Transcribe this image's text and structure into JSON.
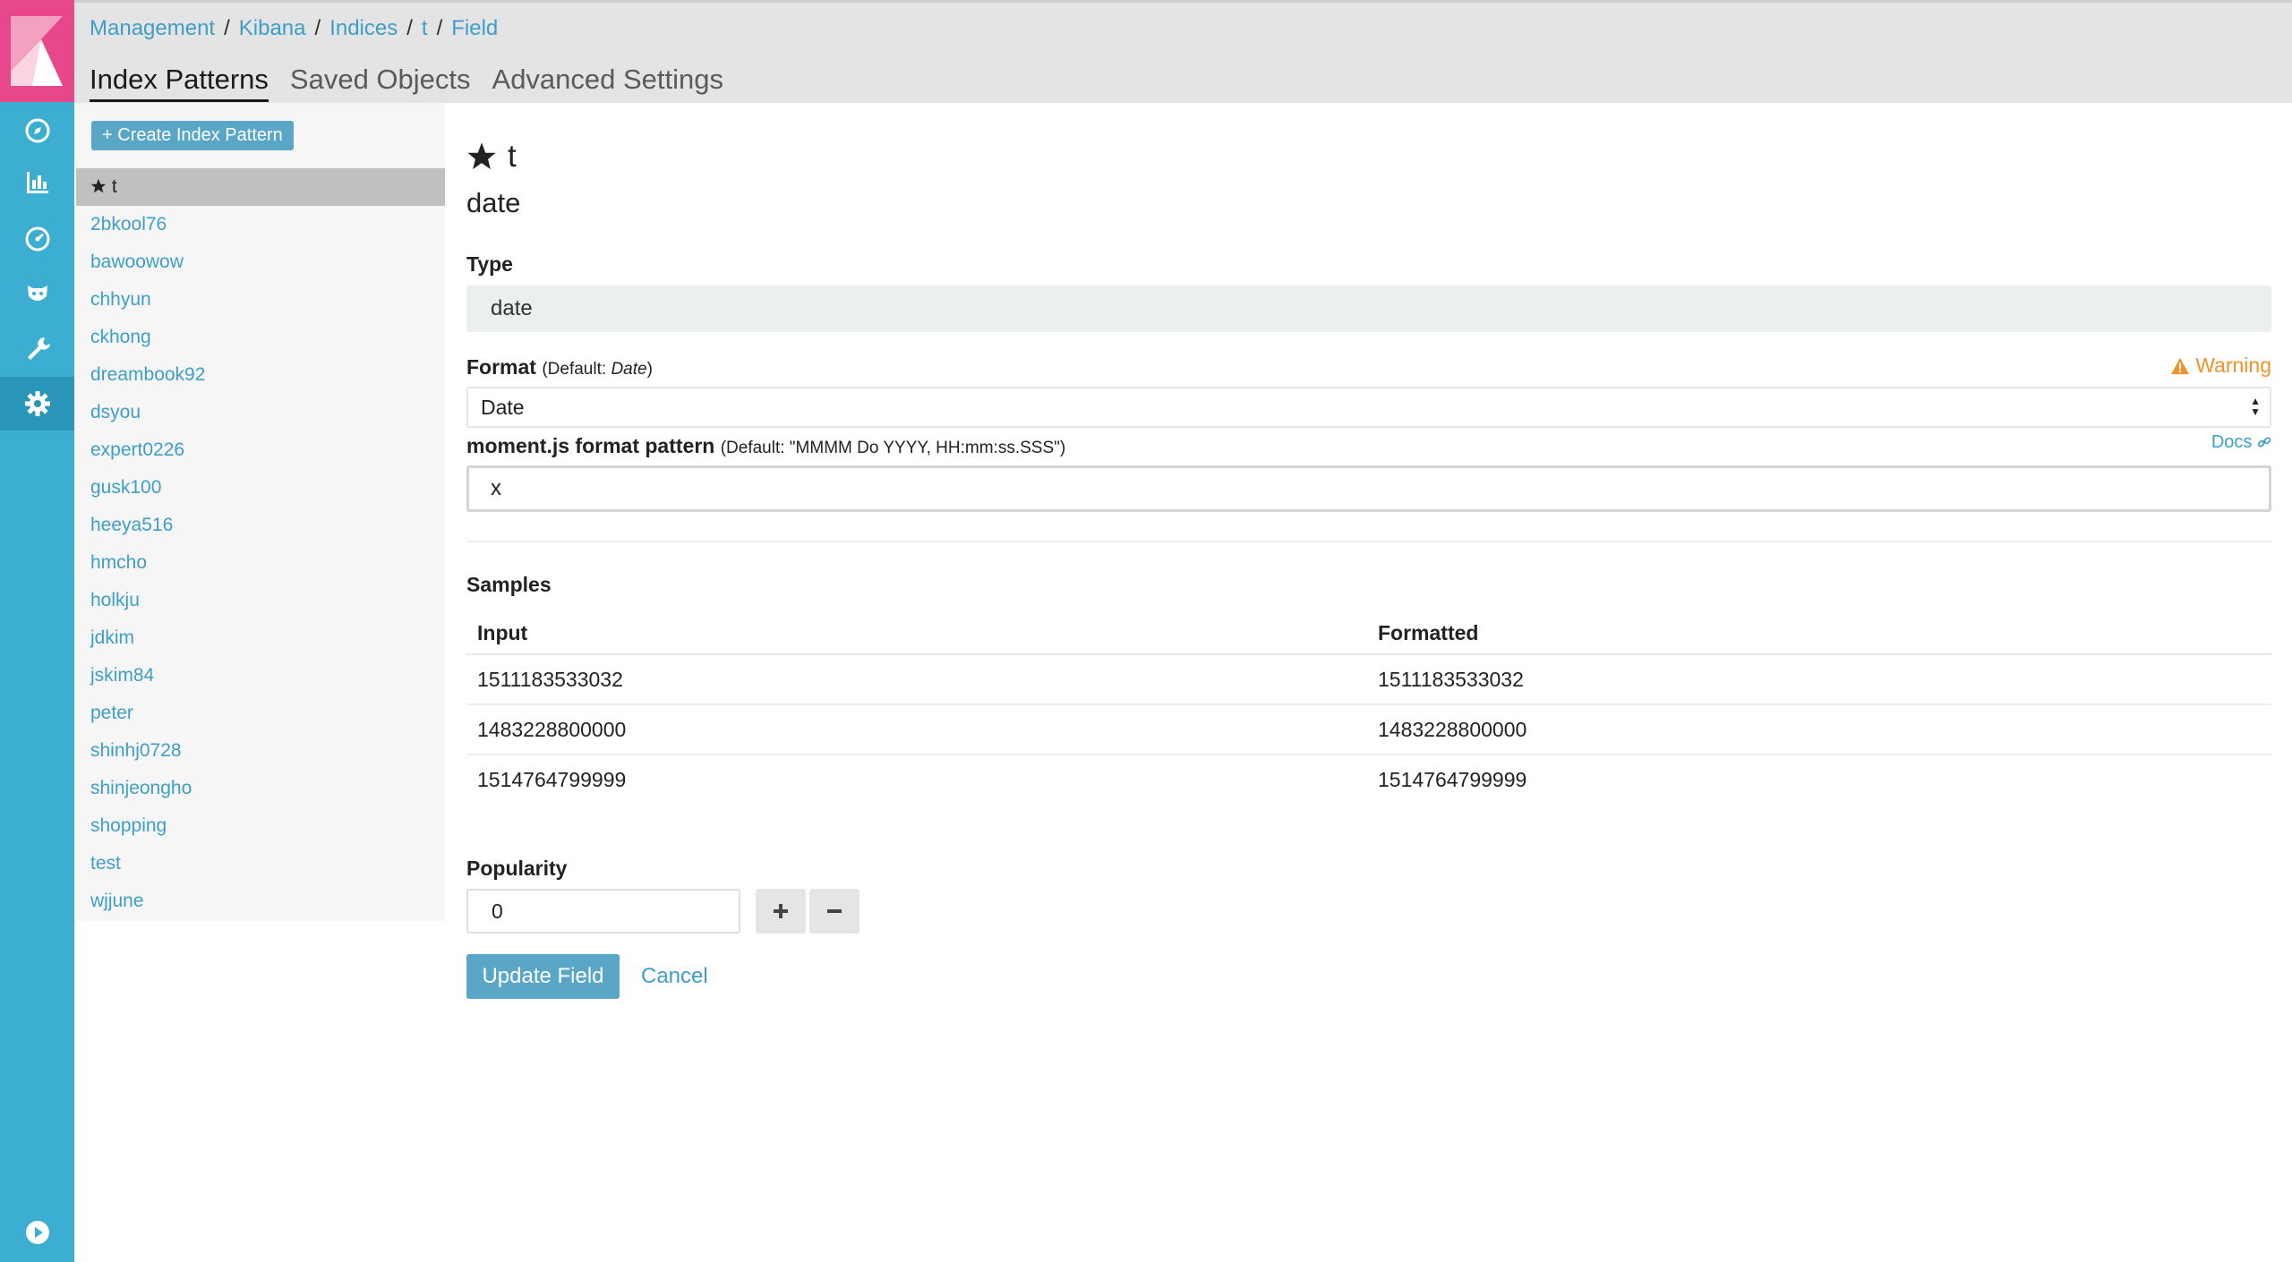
{
  "nav": {
    "icons": [
      "kibana-logo",
      "discover-icon",
      "visualize-icon",
      "dashboard-icon",
      "timelion-icon",
      "devtools-icon",
      "management-icon",
      "collapse-icon"
    ],
    "accent": "#3caed2",
    "logo_color": "#e8488b"
  },
  "breadcrumbs": [
    {
      "label": "Management"
    },
    {
      "label": "Kibana"
    },
    {
      "label": "Indices"
    },
    {
      "label": "t"
    },
    {
      "label": "Field"
    }
  ],
  "tabs": [
    {
      "label": "Index Patterns",
      "active": true
    },
    {
      "label": "Saved Objects"
    },
    {
      "label": "Advanced Settings"
    }
  ],
  "sidebar": {
    "create_button": "+ Create Index Pattern",
    "index_patterns": [
      {
        "label": "t",
        "active": true,
        "default": true
      },
      {
        "label": "2bkool76"
      },
      {
        "label": "bawoowow"
      },
      {
        "label": "chhyun"
      },
      {
        "label": "ckhong"
      },
      {
        "label": "dreambook92"
      },
      {
        "label": "dsyou"
      },
      {
        "label": "expert0226"
      },
      {
        "label": "gusk100"
      },
      {
        "label": "heeya516"
      },
      {
        "label": "hmcho"
      },
      {
        "label": "holkju"
      },
      {
        "label": "jdkim"
      },
      {
        "label": "jskim84"
      },
      {
        "label": "peter"
      },
      {
        "label": "shinhj0728"
      },
      {
        "label": "shinjeongho"
      },
      {
        "label": "shopping"
      },
      {
        "label": "test"
      },
      {
        "label": "wjjune"
      }
    ]
  },
  "field": {
    "index_name": "t",
    "field_name": "date",
    "type_label": "Type",
    "type_value": "date",
    "format_label": "Format",
    "format_default_prefix": "(Default: ",
    "format_default_value": "Date",
    "format_default_suffix": ")",
    "warning": "Warning",
    "format_value": "Date",
    "pattern_label": "moment.js format pattern",
    "pattern_default": "(Default: \"MMMM Do YYYY, HH:mm:ss.SSS\")",
    "docs_link": "Docs",
    "pattern_value": "x",
    "samples_label": "Samples",
    "samples_columns": [
      "Input",
      "Formatted"
    ],
    "samples": [
      [
        "1511183533032",
        "1511183533032"
      ],
      [
        "1483228800000",
        "1483228800000"
      ],
      [
        "1514764799999",
        "1514764799999"
      ]
    ],
    "popularity_label": "Popularity",
    "popularity_value": "0",
    "update_button": "Update Field",
    "cancel_link": "Cancel"
  }
}
